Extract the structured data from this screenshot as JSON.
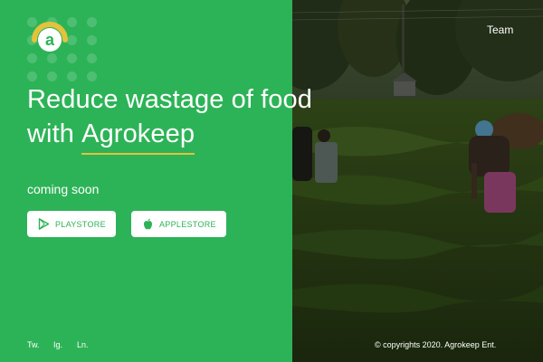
{
  "brand": {
    "logo_letter": "a",
    "name": "Agrokeep"
  },
  "hero": {
    "line1": "Reduce wastage of food",
    "line2_prefix": "with ",
    "line2_brand": "Agrokeep",
    "subtitle": "coming soon"
  },
  "stores": {
    "playstore": {
      "label": "PLAYSTORE",
      "icon": "google-play-icon"
    },
    "applestore": {
      "label": "APPLESTORE",
      "icon": "apple-icon"
    }
  },
  "nav": {
    "team": "Team"
  },
  "social": {
    "twitter": "Tw.",
    "instagram": "Ig.",
    "linkedin": "Ln."
  },
  "footer": {
    "copyright": "© copyrights 2020. Agrokeep Ent."
  },
  "colors": {
    "brand_green": "#2db357",
    "accent_yellow": "#e3c23c",
    "white": "#ffffff"
  }
}
